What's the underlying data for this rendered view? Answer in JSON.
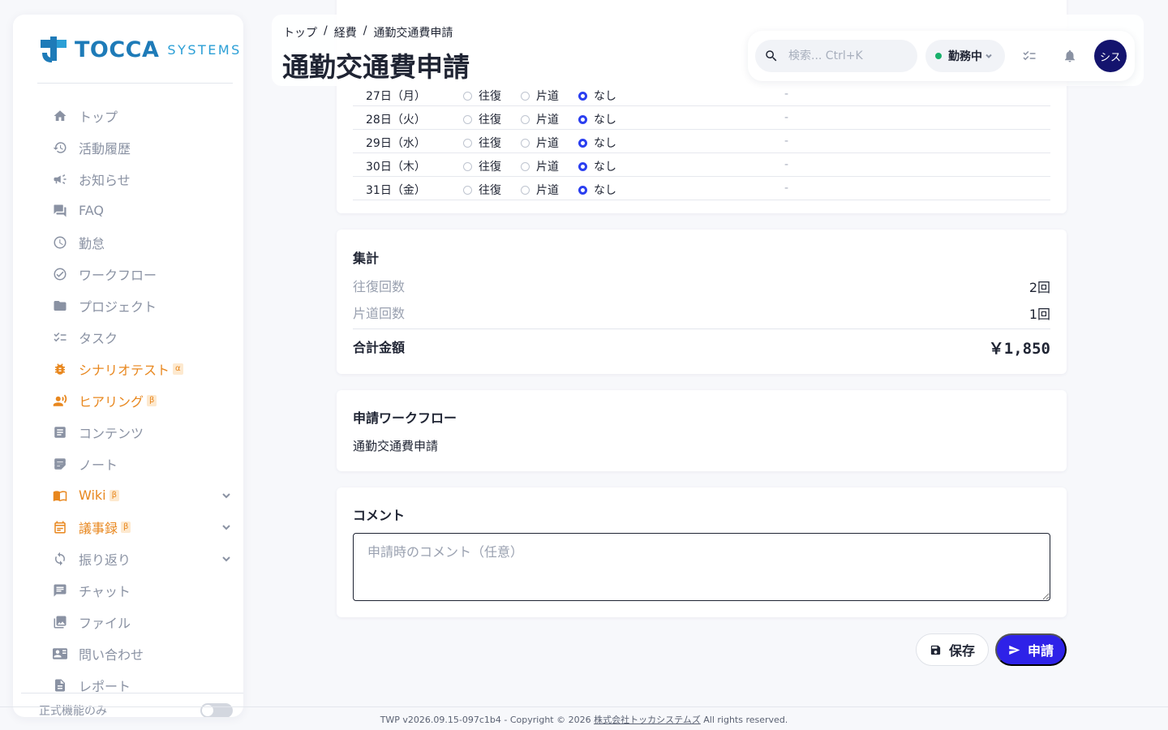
{
  "brand": {
    "name": "TOCCA",
    "sub": "SYSTEMS"
  },
  "sidebar": {
    "items": [
      {
        "label": "トップ",
        "icon": "home-icon"
      },
      {
        "label": "活動履歴",
        "icon": "history-icon"
      },
      {
        "label": "お知らせ",
        "icon": "megaphone-icon"
      },
      {
        "label": "FAQ",
        "icon": "forum-icon"
      },
      {
        "label": "勤怠",
        "icon": "clock-icon"
      },
      {
        "label": "ワークフロー",
        "icon": "check-circle-icon"
      },
      {
        "label": "プロジェクト",
        "icon": "folder-icon"
      },
      {
        "label": "タスク",
        "icon": "checklist-icon"
      },
      {
        "label": "シナリオテスト",
        "icon": "bug-icon",
        "badge": "α"
      },
      {
        "label": "ヒアリング",
        "icon": "record-voice-icon",
        "badge": "β"
      },
      {
        "label": "コンテンツ",
        "icon": "article-icon"
      },
      {
        "label": "ノート",
        "icon": "note-icon"
      },
      {
        "label": "Wiki",
        "icon": "book-icon",
        "badge": "β"
      },
      {
        "label": "議事録",
        "icon": "calendar-icon",
        "badge": "β"
      },
      {
        "label": "振り返り",
        "icon": "refresh-icon"
      },
      {
        "label": "チャット",
        "icon": "chat-icon"
      },
      {
        "label": "ファイル",
        "icon": "image-icon"
      },
      {
        "label": "問い合わせ",
        "icon": "contact-card-icon"
      },
      {
        "label": "レポート",
        "icon": "report-icon"
      }
    ],
    "official_only_label": "正式機能のみ",
    "official_only_on": false
  },
  "header": {
    "breadcrumb": [
      "トップ",
      "経費",
      "通勤交通費申請"
    ],
    "separator": "/",
    "title": "通勤交通費申請",
    "search_placeholder": "検索... Ctrl+K",
    "status_label": "勤務中",
    "avatar_label": "シス"
  },
  "days": {
    "options": [
      "往復",
      "片道",
      "なし"
    ],
    "rows": [
      {
        "day": "27日（月）",
        "selected": "なし",
        "amount": "-"
      },
      {
        "day": "28日（火）",
        "selected": "なし",
        "amount": "-"
      },
      {
        "day": "29日（水）",
        "selected": "なし",
        "amount": "-"
      },
      {
        "day": "30日（木）",
        "selected": "なし",
        "amount": "-"
      },
      {
        "day": "31日（金）",
        "selected": "なし",
        "amount": "-"
      }
    ]
  },
  "summary": {
    "title": "集計",
    "round_trip_label": "往復回数",
    "round_trip_value": "2回",
    "one_way_label": "片道回数",
    "one_way_value": "1回",
    "total_label": "合計金額",
    "total_value": "￥1,850"
  },
  "workflow": {
    "title": "申請ワークフロー",
    "name": "通勤交通費申請"
  },
  "comment": {
    "title": "コメント",
    "placeholder": "申請時のコメント（任意）"
  },
  "actions": {
    "save_label": "保存",
    "submit_label": "申請"
  },
  "footer": {
    "prefix": "TWP v2026.09.15-097c1b4 - Copyright © 2026 ",
    "company": "株式会社トッカシステムズ",
    "suffix": " All rights reserved."
  },
  "colors": {
    "accent": "#2e22e8",
    "orange": "#e8871e",
    "avatar": "#14146e",
    "status_dot": "#18b06b"
  }
}
